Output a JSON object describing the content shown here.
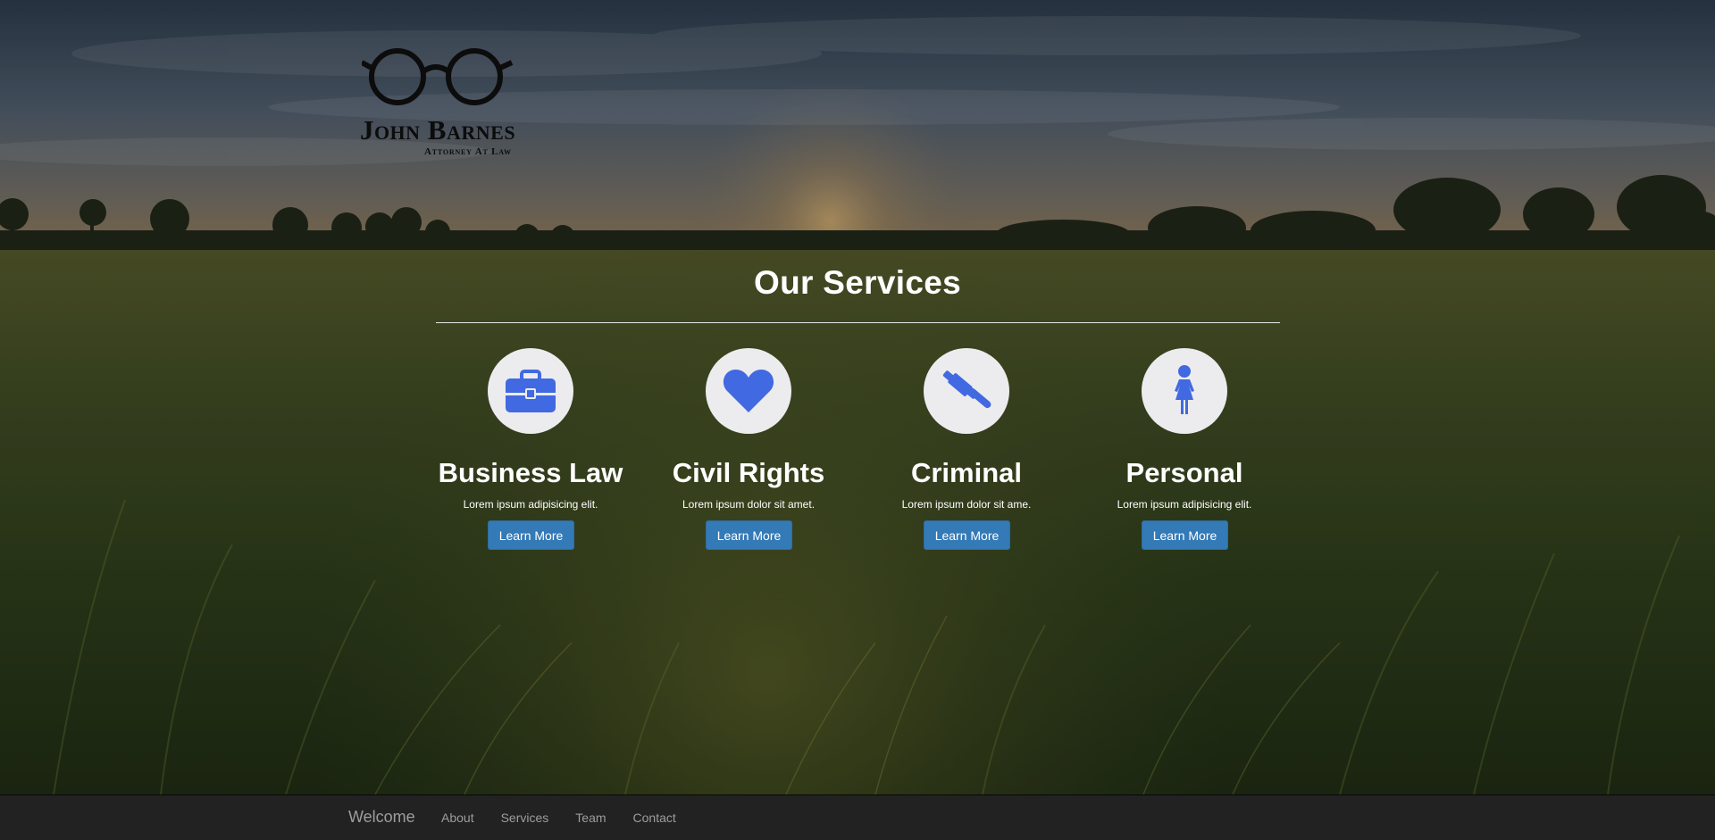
{
  "logo": {
    "name": "John Barnes",
    "subtitle": "Attorney At Law",
    "icon": "glasses-icon"
  },
  "services": {
    "title": "Our Services",
    "items": [
      {
        "icon": "briefcase-icon",
        "title": "Business Law",
        "description": "Lorem ipsum adipisicing elit.",
        "button": "Learn More"
      },
      {
        "icon": "heart-icon",
        "title": "Civil Rights",
        "description": "Lorem ipsum dolor sit amet.",
        "button": "Learn More"
      },
      {
        "icon": "gavel-icon",
        "title": "Criminal",
        "description": "Lorem ipsum dolor sit ame.",
        "button": "Learn More"
      },
      {
        "icon": "female-icon",
        "title": "Personal",
        "description": "Lorem ipsum adipisicing elit.",
        "button": "Learn More"
      }
    ]
  },
  "navbar": {
    "brand": "Welcome",
    "links": [
      "About",
      "Services",
      "Team",
      "Contact"
    ]
  },
  "colors": {
    "accent": "#337ab7",
    "icon": "#4169e1",
    "navbar_bg": "#222222",
    "navbar_text": "#9d9d9d"
  }
}
